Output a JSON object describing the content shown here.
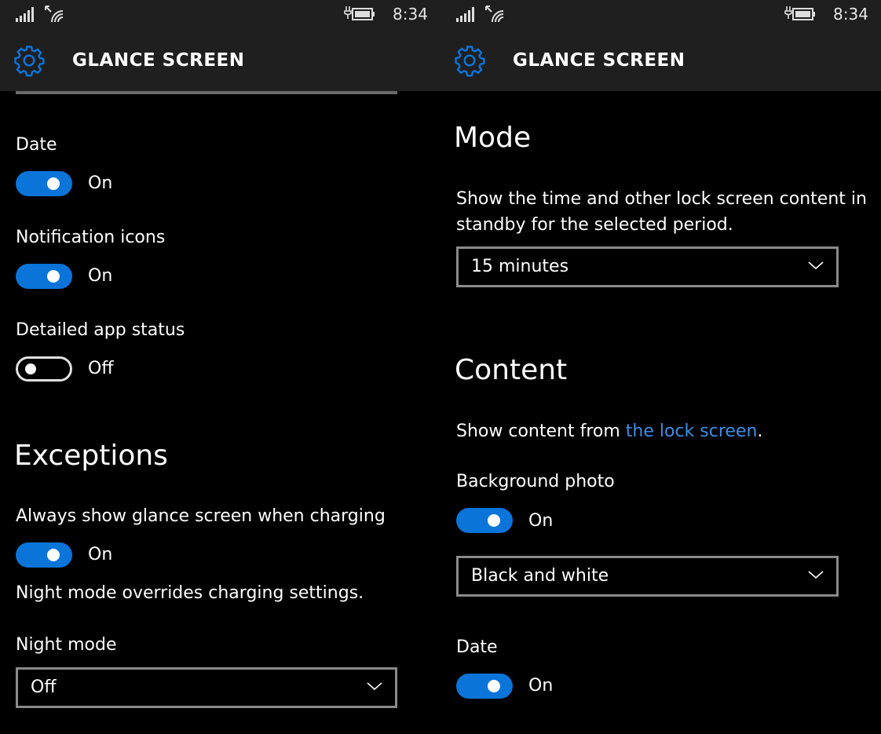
{
  "status": {
    "time": "8:34"
  },
  "header": {
    "title": "GLANCE SCREEN",
    "icon": "gear-icon",
    "accent": "#0a74d9"
  },
  "left": {
    "date": {
      "label": "Date",
      "state": "On",
      "on": true
    },
    "notification_icons": {
      "label": "Notification icons",
      "state": "On",
      "on": true
    },
    "detailed_app_status": {
      "label": "Detailed app status",
      "state": "Off",
      "on": false
    },
    "exceptions": {
      "heading": "Exceptions",
      "always_show": {
        "label": "Always show glance screen when charging",
        "state": "On",
        "on": true
      },
      "note": "Night mode overrides charging settings."
    },
    "night_mode": {
      "label": "Night mode",
      "value": "Off"
    }
  },
  "right": {
    "mode": {
      "heading": "Mode",
      "description": "Show the time and other lock screen content in standby for the selected period.",
      "value": "15 minutes"
    },
    "content": {
      "heading": "Content",
      "desc_prefix": "Show content from ",
      "desc_link": "the lock screen",
      "desc_suffix": "."
    },
    "background_photo": {
      "label": "Background photo",
      "state": "On",
      "on": true,
      "style_value": "Black and white"
    },
    "date": {
      "label": "Date",
      "state": "On",
      "on": true
    }
  }
}
